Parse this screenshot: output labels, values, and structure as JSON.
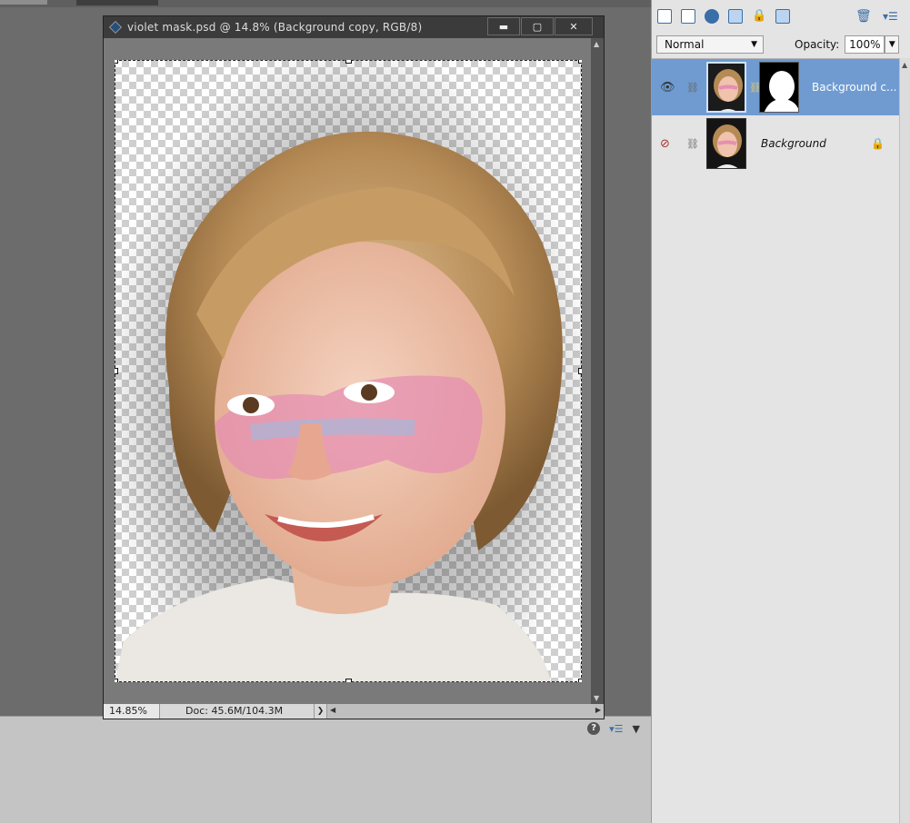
{
  "document": {
    "title": "violet  mask.psd @ 14.8% (Background copy, RGB/8)",
    "zoom": "14.85%",
    "doc_size": "Doc: 45.6M/104.3M"
  },
  "window_controls": {
    "minimize": "▬",
    "maximize": "▢",
    "close": "✕"
  },
  "layers_panel": {
    "blend_mode": "Normal",
    "opacity_label": "Opacity:",
    "opacity_value": "100%",
    "layers": [
      {
        "name": "Background c...",
        "visible": true,
        "selected": true,
        "has_mask": true
      },
      {
        "name": "Background",
        "visible": false,
        "selected": false,
        "has_mask": false,
        "locked": true
      }
    ]
  },
  "colors": {
    "selection": "#6f9bd1",
    "accent": "#3a6ea8"
  }
}
